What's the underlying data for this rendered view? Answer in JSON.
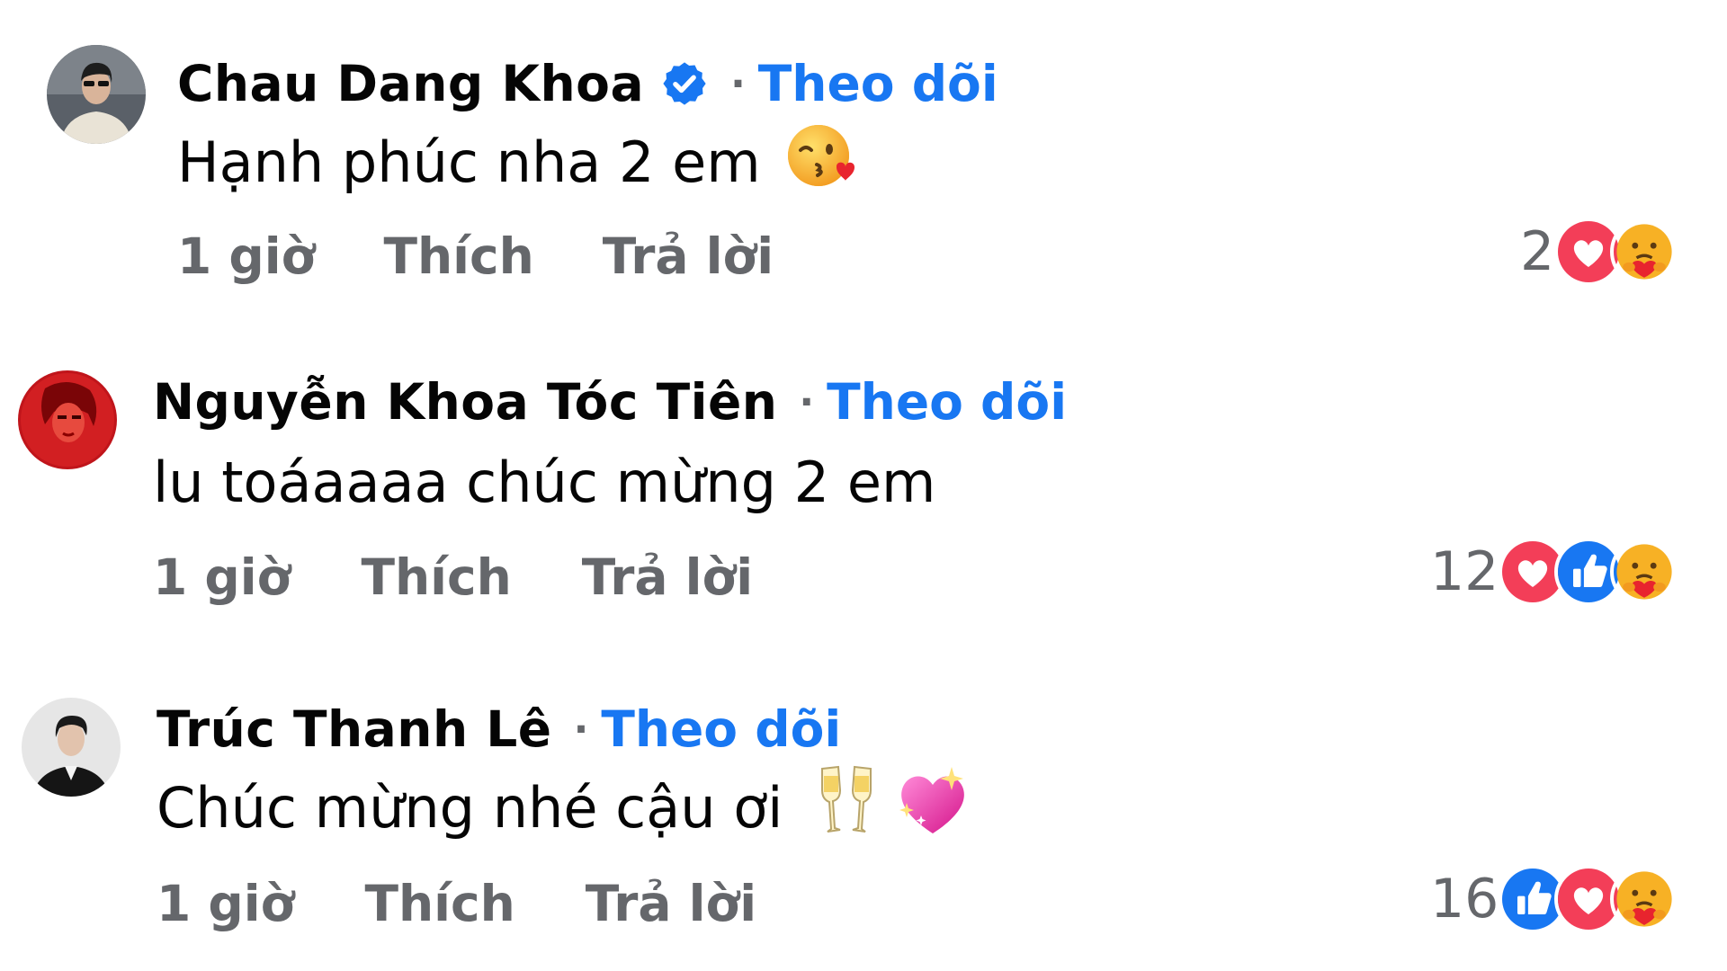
{
  "colors": {
    "follow": "#1877f2",
    "meta": "#65676b",
    "text": "#050505",
    "love": "#f33e58",
    "like": "#1877f2",
    "care": "#f7b125"
  },
  "comments": [
    {
      "author": "Chau Dang Khoa",
      "verified": true,
      "follow_label": "Theo dõi",
      "text": "Hạnh phúc nha 2 em",
      "text_emoji": [
        "face-blowing-kiss-icon"
      ],
      "time": "1 giờ",
      "like_label": "Thích",
      "reply_label": "Trả lời",
      "reaction_count": "2",
      "reactions": [
        "love-reaction-icon",
        "care-reaction-icon"
      ]
    },
    {
      "author": "Nguyễn Khoa Tóc Tiên",
      "verified": false,
      "follow_label": "Theo dõi",
      "text": "lu toáaaaa chúc mừng 2 em",
      "text_emoji": [],
      "time": "1 giờ",
      "like_label": "Thích",
      "reply_label": "Trả lời",
      "reaction_count": "12",
      "reactions": [
        "love-reaction-icon",
        "like-reaction-icon",
        "care-reaction-icon"
      ]
    },
    {
      "author": "Trúc Thanh Lê",
      "verified": false,
      "follow_label": "Theo dõi",
      "text": "Chúc mừng nhé cậu ơi",
      "text_emoji": [
        "clinking-glasses-icon",
        "sparkling-heart-icon"
      ],
      "time": "1 giờ",
      "like_label": "Thích",
      "reply_label": "Trả lời",
      "reaction_count": "16",
      "reactions": [
        "like-reaction-icon",
        "love-reaction-icon",
        "care-reaction-icon"
      ]
    }
  ]
}
